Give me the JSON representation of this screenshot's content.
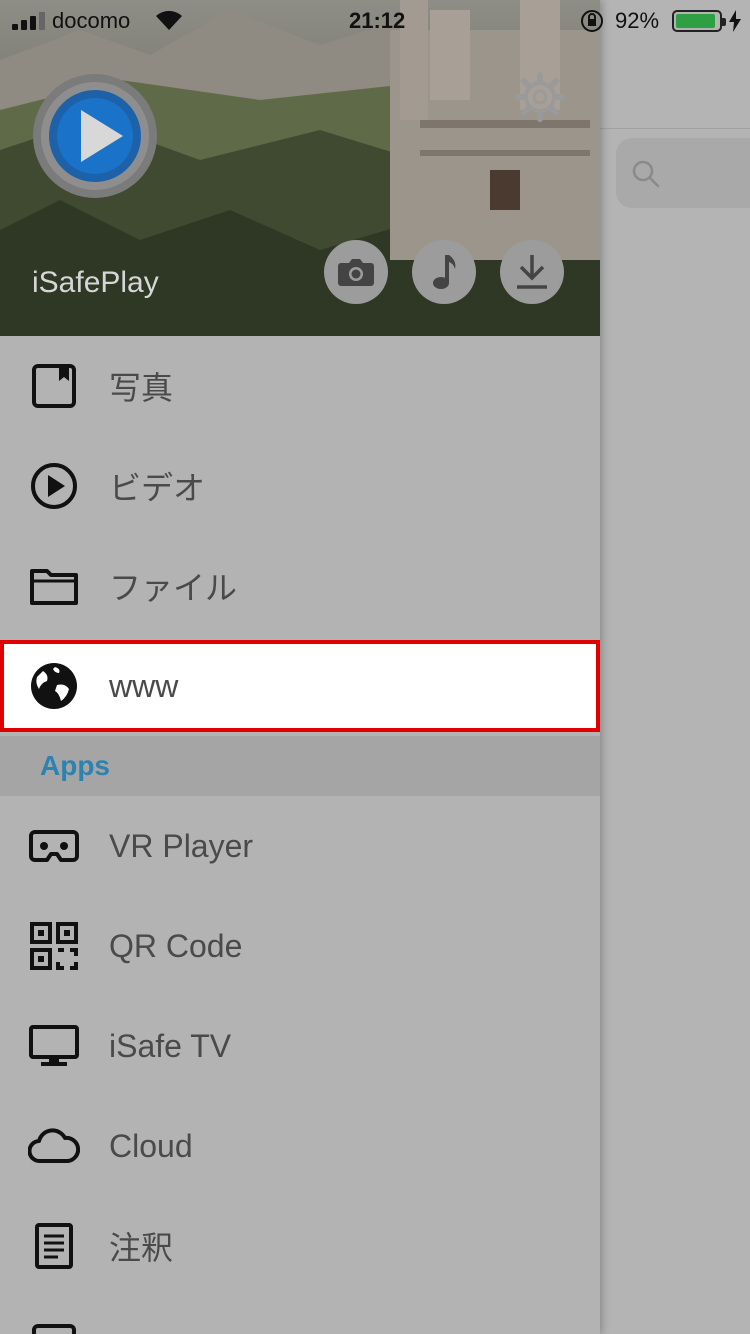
{
  "status_bar": {
    "carrier": "docomo",
    "time": "21:12",
    "battery_percent": "92%",
    "battery_level": 0.92
  },
  "header": {
    "app_name": "iSafePlay",
    "quick_actions": [
      "camera-icon",
      "music-note-icon",
      "download-icon"
    ]
  },
  "menu": {
    "items": [
      {
        "label": "写真",
        "icon": "photo-icon"
      },
      {
        "label": "ビデオ",
        "icon": "play-circle-icon"
      },
      {
        "label": "ファイル",
        "icon": "folder-icon"
      },
      {
        "label": "www",
        "icon": "globe-icon",
        "selected": true
      }
    ],
    "apps_section_title": "Apps",
    "apps": [
      {
        "label": "VR Player",
        "icon": "vr-headset-icon"
      },
      {
        "label": "QR Code",
        "icon": "qr-code-icon"
      },
      {
        "label": "iSafe TV",
        "icon": "monitor-icon"
      },
      {
        "label": "Cloud",
        "icon": "cloud-icon"
      },
      {
        "label": "注釈",
        "icon": "note-icon"
      }
    ]
  },
  "colors": {
    "section_title": "#2c82b0",
    "selection_outline": "#e00000",
    "battery_fill": "#2ea043"
  }
}
